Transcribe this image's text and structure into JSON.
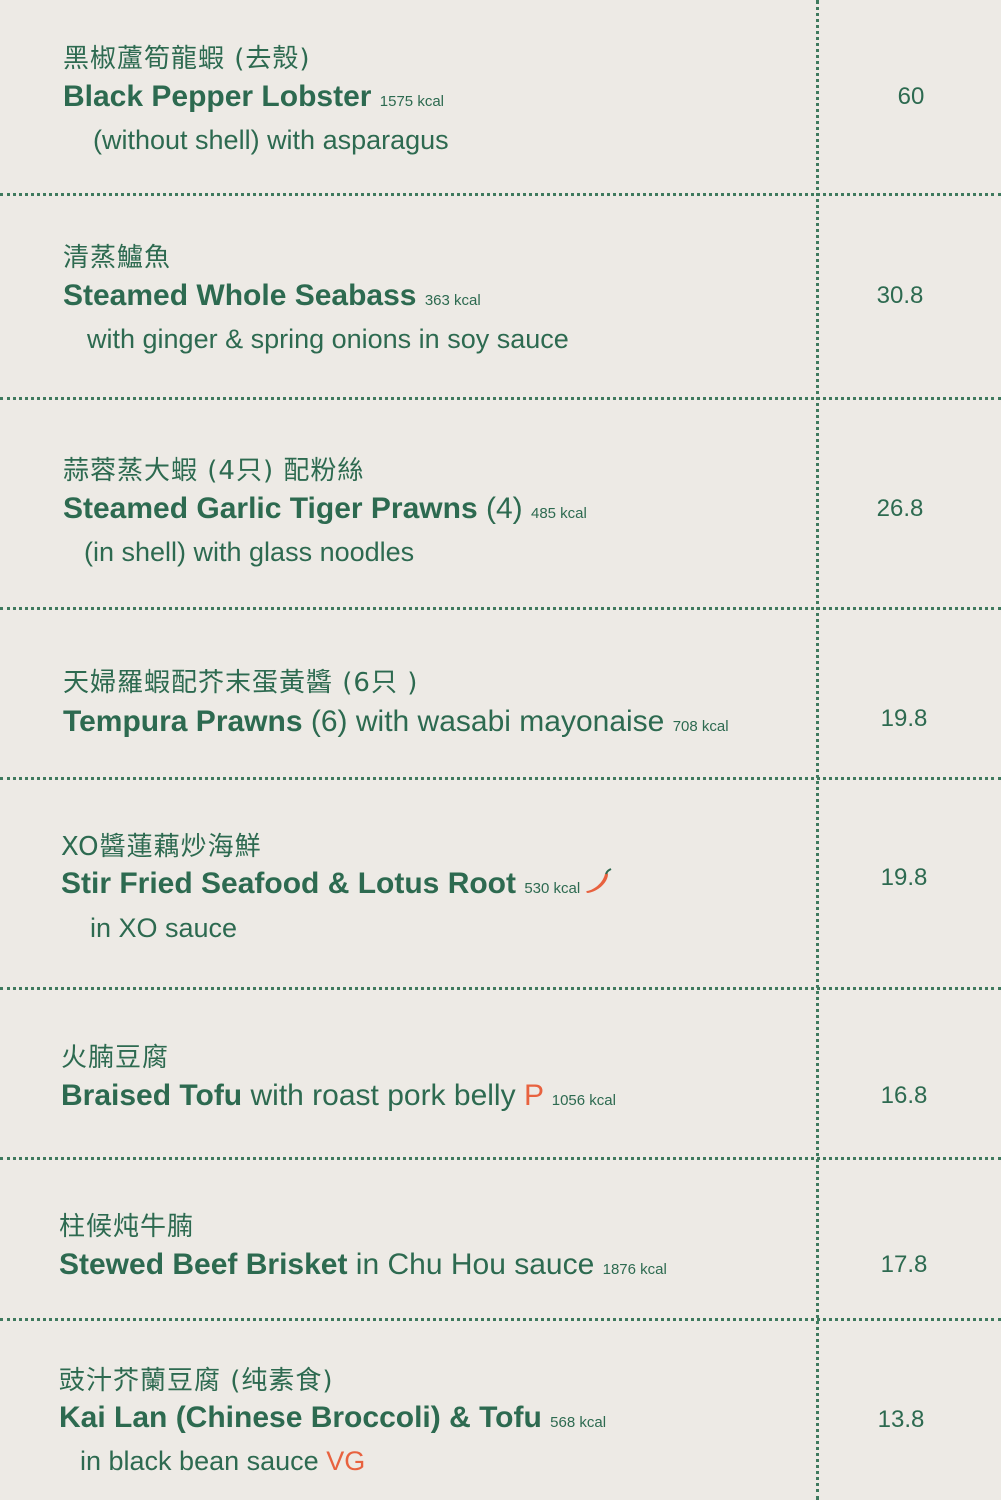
{
  "items": [
    {
      "zh": "黑椒蘆筍龍蝦 (去殼)",
      "name": "Black Pepper Lobster",
      "extra": "",
      "kcal": "1575 kcal",
      "desc": "(without shell) with asparagus",
      "price": "60"
    },
    {
      "zh": "清蒸鱸魚",
      "name": "Steamed Whole Seabass",
      "extra": "",
      "kcal": "363 kcal",
      "desc": "with ginger & spring onions in soy sauce",
      "price": "30.8"
    },
    {
      "zh": "蒜蓉蒸大蝦 (4只) 配粉絲",
      "name": "Steamed Garlic Tiger Prawns",
      "extra": "(4)",
      "kcal": "485 kcal",
      "desc": "(in shell)  with glass noodles",
      "price": "26.8"
    },
    {
      "zh": "天婦羅蝦配芥末蛋黃醬 (6只 )",
      "name": "Tempura Prawns",
      "extra": "(6) with wasabi mayonaise",
      "kcal": "708 kcal",
      "desc": "",
      "price": "19.8"
    },
    {
      "zh": "XO醬蓮藕炒海鮮",
      "name": "Stir Fried Seafood & Lotus Root",
      "extra": "",
      "kcal": "530 kcal",
      "desc": "in XO sauce",
      "price": "19.8",
      "icon": "chili-pepper-icon"
    },
    {
      "zh": "火腩豆腐",
      "name": "Braised Tofu",
      "extra": "with roast pork belly",
      "tag": "P",
      "kcal": "1056 kcal",
      "desc": "",
      "price": "16.8"
    },
    {
      "zh": "柱候炖牛腩",
      "name": "Stewed Beef Brisket",
      "extra": "in Chu Hou sauce",
      "kcal": "1876 kcal",
      "desc": "",
      "price": "17.8"
    },
    {
      "zh": "豉汁芥蘭豆腐 (纯素食)",
      "name": "Kai Lan (Chinese Broccoli) & Tofu",
      "extra": "",
      "kcal": "568 kcal",
      "desc": "in black bean sauce",
      "desc_tag": "VG",
      "price": "13.8"
    }
  ],
  "colors": {
    "background": "#edeae5",
    "text": "#2d6a50",
    "accent": "#e8623f"
  }
}
